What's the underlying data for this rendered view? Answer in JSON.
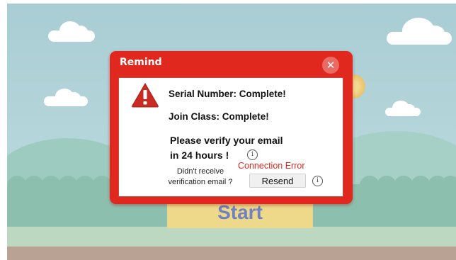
{
  "background": {
    "start_label": "Start"
  },
  "dialog": {
    "title": "Remind",
    "close_icon": "close-icon",
    "warning_icon": "warning-triangle-icon",
    "lines": {
      "serial": "Serial Number: Complete!",
      "join": "Join Class: Complete!",
      "verify_line1": "Please verify your email",
      "verify_line2": "in 24 hours !"
    },
    "error_text": "Connection Error",
    "didnt_receive": "Didn't receive verification email ?",
    "resend_label": "Resend",
    "info_icon_glyph": "i"
  },
  "colors": {
    "dialog_red": "#e0281e",
    "error_red": "#e0281e",
    "start_button": "#eed88a",
    "start_text": "#7282c0",
    "sky": "#a9cdd4"
  }
}
